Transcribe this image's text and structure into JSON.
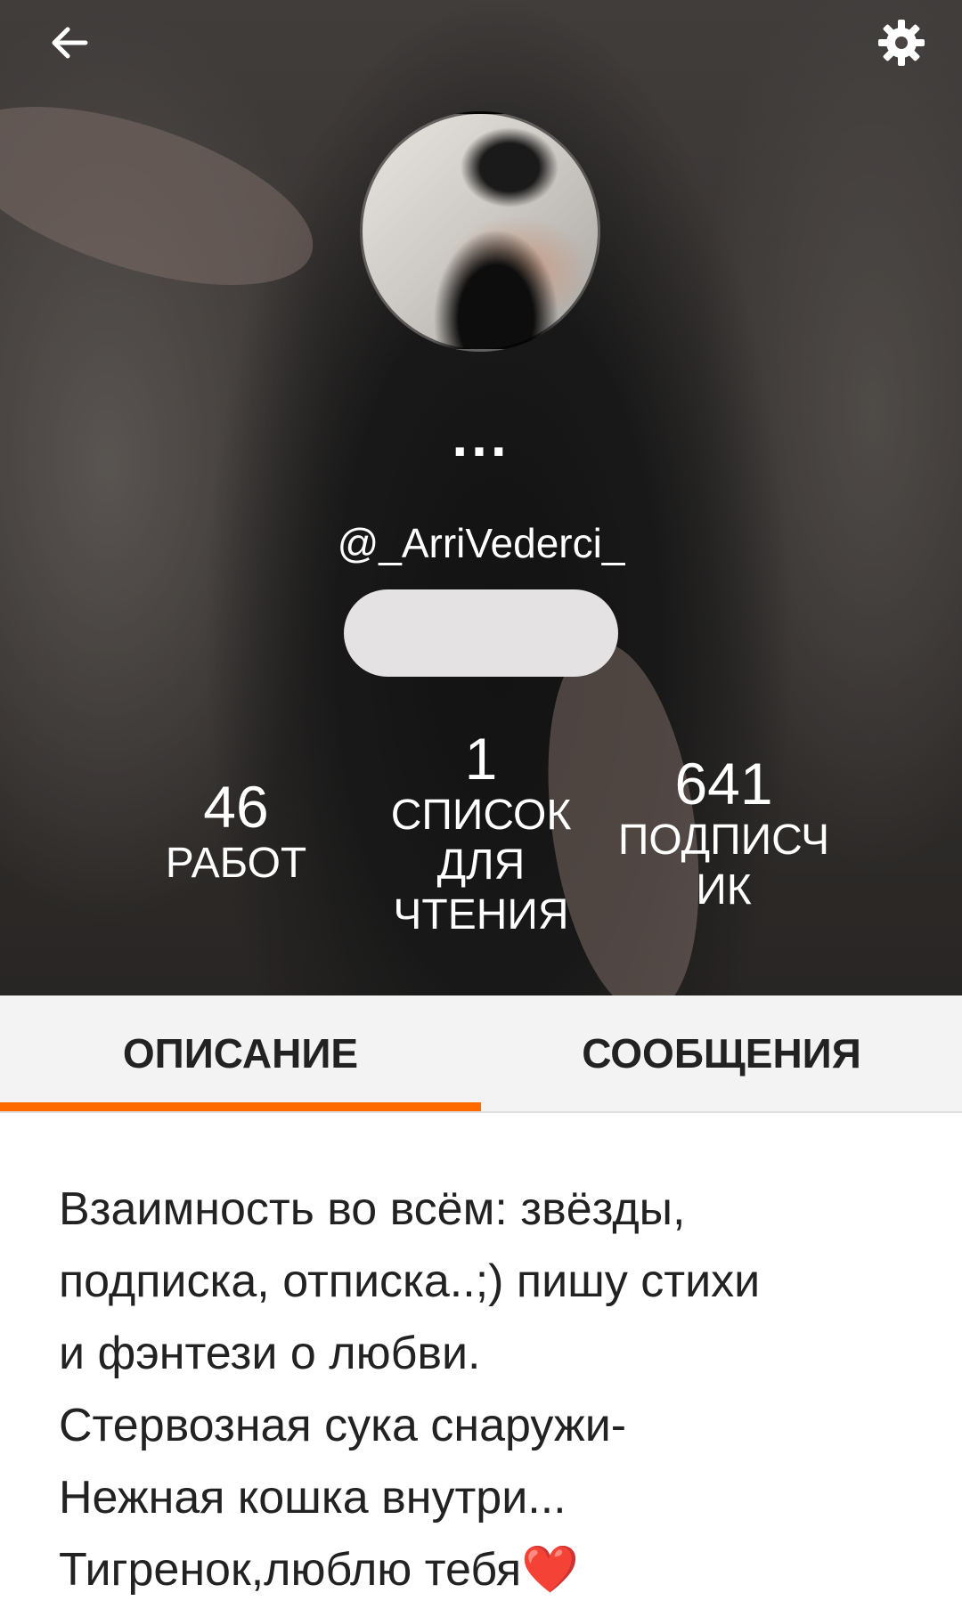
{
  "header": {
    "back_icon": "arrow-left-icon",
    "settings_icon": "gear-icon",
    "more_label": "...",
    "username": "@_ArriVederci_"
  },
  "stats": {
    "works": {
      "value": "46",
      "label": "РАБОТ"
    },
    "reading_lists": {
      "value": "1",
      "label": "СПИСОК ДЛЯ ЧТЕНИЯ"
    },
    "followers": {
      "value": "641",
      "label": "ПОДПИСЧИК"
    }
  },
  "tabs": [
    {
      "label": "ОПИСАНИЕ",
      "active": true
    },
    {
      "label": "СООБЩЕНИЯ",
      "active": false
    }
  ],
  "description": {
    "lines": [
      "Взаимность во всём: звёзды,",
      "подписка, отписка..;) пишу стихи",
      "и фэнтези о любви.",
      "Стервозная сука снаружи-",
      "Нежная кошка внутри...",
      "Тигренок,люблю тебя"
    ],
    "heart_emoji": "❤️"
  },
  "colors": {
    "accent": "#ff6a00",
    "tab_bar": "#f3f3f3",
    "text": "#222222",
    "pill": "#e4e2e3"
  }
}
